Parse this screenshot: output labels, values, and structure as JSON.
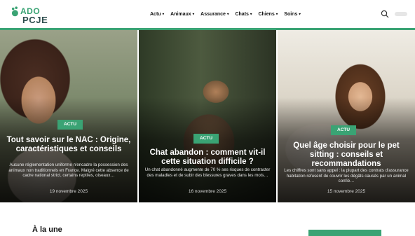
{
  "logo": {
    "line1": "ADO",
    "line2": "PCJE"
  },
  "nav": [
    {
      "label": "Actu"
    },
    {
      "label": "Animaux"
    },
    {
      "label": "Assurance"
    },
    {
      "label": "Chats"
    },
    {
      "label": "Chiens"
    },
    {
      "label": "Soins"
    }
  ],
  "colors": {
    "accent": "#3aa374"
  },
  "hero": [
    {
      "category": "ACTU",
      "title": "Tout savoir sur le NAC : Origine, caractéristiques et conseils",
      "excerpt": "Aucune réglementation uniforme n'encadre la possession des animaux non traditionnels en France. Malgré cette absence de cadre national strict, certains reptiles, oiseaux…",
      "date": "19 novembre 2025"
    },
    {
      "category": "ACTU",
      "title": "Chat abandon : comment vit-il cette situation difficile ?",
      "excerpt": "Un chat abandonné augmente de 70 % ses risques de contracter des maladies et de subir des blessures graves dans les mois…",
      "date": "16 novembre 2025"
    },
    {
      "category": "ACTU",
      "title": "Quel âge choisir pour le pet sitting : conseils et recommandations",
      "excerpt": "Les chiffres sont sans appel : la plupart des contrats d'assurance habitation refusent de couvrir les dégâts causés par un animal confié…",
      "date": "15 novembre 2025"
    }
  ],
  "section": {
    "title": "À la une"
  }
}
